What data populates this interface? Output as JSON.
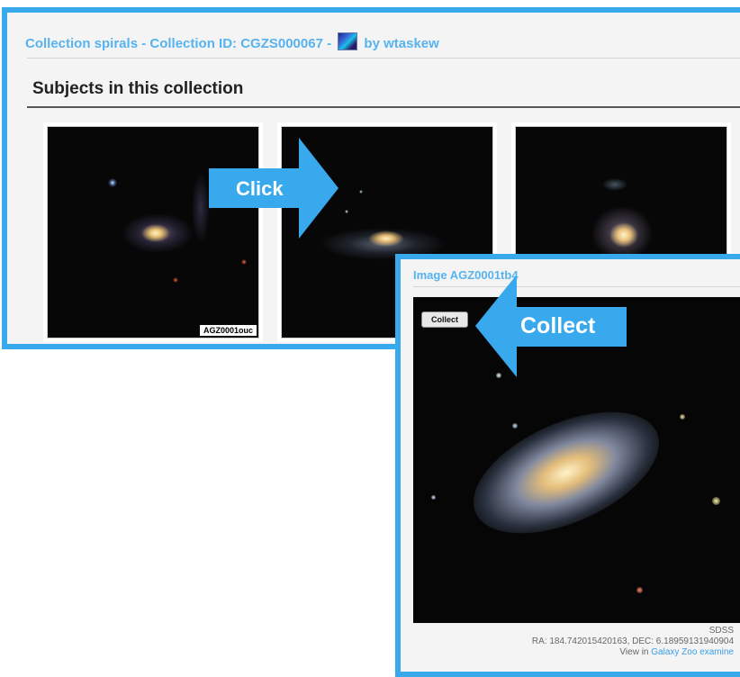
{
  "collection": {
    "header_prefix": "Collection spirals - Collection ID: CGZS000067 -",
    "owner": "by wtaskew",
    "section_title": "Subjects in this collection",
    "subjects": [
      {
        "label": "AGZ0001ouc"
      },
      {
        "label": ""
      },
      {
        "label": ""
      }
    ]
  },
  "callouts": {
    "click_label": "Click",
    "collect_label": "Collect",
    "color": "#39a9ee"
  },
  "detail": {
    "title": "Image AGZ0001tb4",
    "collect_button": "Collect",
    "source": "SDSS",
    "coords": "RA: 184.742015420163, DEC: 6.18959131940904",
    "view_prefix": "View in",
    "view_link_1": "Galaxy Zoo",
    "view_link_2": "examine"
  }
}
